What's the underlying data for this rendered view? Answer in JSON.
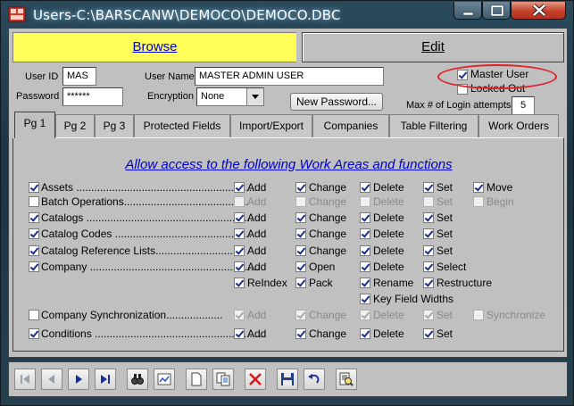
{
  "window": {
    "title": "Users-C:\\BARSCANW\\DEMOCO\\DEMOCO.DBC"
  },
  "mode_tabs": {
    "browse": "Browse",
    "edit": "Edit"
  },
  "header": {
    "user_id_label": "User ID",
    "user_id_value": "MAS",
    "password_label": "Password",
    "password_value": "******",
    "user_name_label": "User Name",
    "user_name_value": "MASTER ADMIN USER",
    "encryption_label": "Encryption",
    "encryption_value": "None",
    "new_password_button": "New Password...",
    "master_user_label": "Master User",
    "master_user_checked": true,
    "locked_out_label": "Locked Out",
    "locked_out_checked": false,
    "max_login_label": "Max # of Login attempts",
    "max_login_value": "5"
  },
  "tabs": [
    {
      "label": "Pg 1",
      "active": true
    },
    {
      "label": "Pg 2"
    },
    {
      "label": "Pg 3"
    },
    {
      "label": "Protected Fields"
    },
    {
      "label": "Import/Export"
    },
    {
      "label": "Companies"
    },
    {
      "label": "Table Filtering"
    },
    {
      "label": "Work Orders"
    }
  ],
  "access_heading": "Allow access to the following Work Areas and functions",
  "work_areas": {
    "assets": {
      "label": "Assets",
      "on": true,
      "add": "Add",
      "change": "Change",
      "delete": "Delete",
      "set": "Set",
      "move": "Move"
    },
    "batch_operations": {
      "label": "Batch Operations",
      "on": false,
      "add": "Add",
      "change": "Change",
      "delete": "Delete",
      "set": "Set",
      "begin": "Begin"
    },
    "catalogs": {
      "label": "Catalogs",
      "on": true,
      "add": "Add",
      "change": "Change",
      "delete": "Delete",
      "set": "Set"
    },
    "catalog_codes": {
      "label": "Catalog Codes",
      "on": true,
      "add": "Add",
      "change": "Change",
      "delete": "Delete",
      "set": "Set"
    },
    "catalog_reference_lists": {
      "label": "Catalog Reference Lists",
      "on": true,
      "add": "Add",
      "change": "Change",
      "delete": "Delete",
      "set": "Set"
    },
    "company": {
      "label": "Company",
      "on": true,
      "add": "Add",
      "open": "Open",
      "delete": "Delete",
      "select": "Select",
      "reindex": "ReIndex",
      "pack": "Pack",
      "rename": "Rename",
      "restructure": "Restructure",
      "key_field_widths": "Key Field Widths"
    },
    "company_synchronization": {
      "label": "Company Synchronization",
      "on": false,
      "add": "Add",
      "change": "Change",
      "delete": "Delete",
      "set": "Set",
      "synchronize": "Synchronize"
    },
    "conditions": {
      "label": "Conditions",
      "on": true,
      "add": "Add",
      "change": "Change",
      "delete": "Delete",
      "set": "Set"
    }
  },
  "toolbar": {
    "icons": [
      "first-record-icon",
      "previous-record-icon",
      "next-record-icon",
      "last-record-icon",
      "find-icon",
      "filter-icon",
      "new-record-icon",
      "copy-record-icon",
      "delete-record-icon",
      "save-icon",
      "undo-icon",
      "report-icon"
    ]
  },
  "colors": {
    "browse_tab": "#ffff57",
    "heading_link": "#0000cc",
    "annotation_oval": "#e0202a",
    "close_button": "#c2402a"
  }
}
